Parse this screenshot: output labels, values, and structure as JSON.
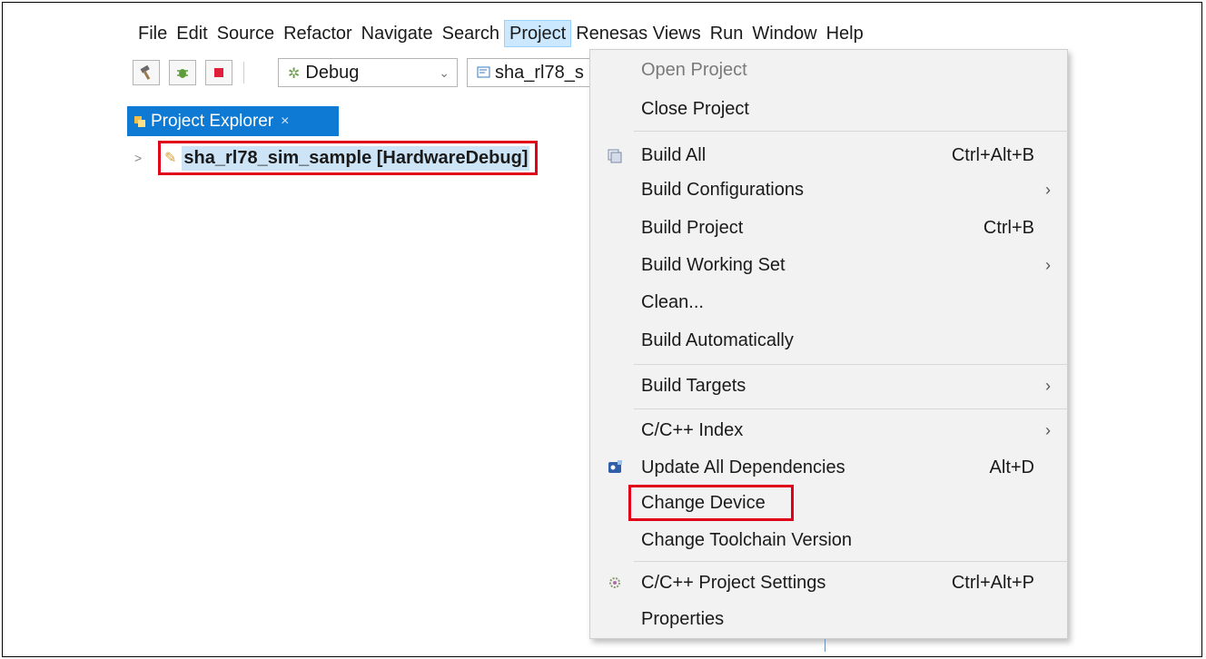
{
  "menubar": {
    "items": [
      "File",
      "Edit",
      "Source",
      "Refactor",
      "Navigate",
      "Search",
      "Project",
      "Renesas Views",
      "Run",
      "Window",
      "Help"
    ],
    "active": "Project"
  },
  "toolbar": {
    "config_combo": "Debug",
    "launch_combo": "sha_rl78_s"
  },
  "project_explorer": {
    "tab_label": "Project Explorer",
    "close_glyph": "×",
    "project_label": "sha_rl78_sim_sample [HardwareDebug]"
  },
  "project_menu": {
    "items": [
      {
        "label": "Open Project",
        "accel": "",
        "submenu": false,
        "disabled": true
      },
      {
        "label": "Close Project",
        "accel": "",
        "submenu": false
      },
      {
        "label": "Build All",
        "accel": "Ctrl+Alt+B",
        "submenu": false,
        "icon": "build-all-icon"
      },
      {
        "label": "Build Configurations",
        "accel": "",
        "submenu": true
      },
      {
        "label": "Build Project",
        "accel": "Ctrl+B",
        "submenu": false
      },
      {
        "label": "Build Working Set",
        "accel": "",
        "submenu": true
      },
      {
        "label": "Clean...",
        "accel": "",
        "submenu": false
      },
      {
        "label": "Build Automatically",
        "accel": "",
        "submenu": false
      },
      {
        "label": "Build Targets",
        "accel": "",
        "submenu": true
      },
      {
        "label": "C/C++ Index",
        "accel": "",
        "submenu": true
      },
      {
        "label": "Update All Dependencies",
        "accel": "Alt+D",
        "submenu": false,
        "icon": "dependencies-icon"
      },
      {
        "label": "Change Device",
        "accel": "",
        "submenu": false,
        "highlighted": true
      },
      {
        "label": "Change Toolchain Version",
        "accel": "",
        "submenu": false
      },
      {
        "label": "C/C++ Project Settings",
        "accel": "Ctrl+Alt+P",
        "submenu": false,
        "icon": "settings-icon"
      },
      {
        "label": "Properties",
        "accel": "",
        "submenu": false
      }
    ],
    "submenu_glyph": "›"
  },
  "colors": {
    "highlight_box": "#e0001a",
    "tab_active": "#0e7ad4",
    "menu_bg": "#f2f2f2",
    "menubar_active": "#cce8ff"
  }
}
